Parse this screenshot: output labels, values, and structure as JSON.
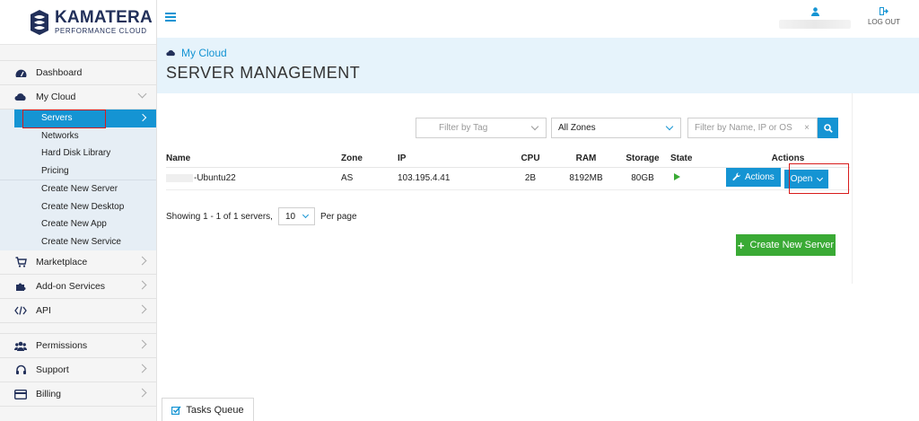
{
  "brand": {
    "name": "KAMATERA",
    "tagline": "PERFORMANCE CLOUD"
  },
  "header": {
    "logout_label": "LOG OUT"
  },
  "breadcrumb": "My Cloud",
  "page_title": "SERVER MANAGEMENT",
  "sidebar": {
    "items": [
      {
        "label": "Dashboard",
        "icon": "dashboard-icon"
      },
      {
        "label": "My Cloud",
        "icon": "cloud-icon"
      },
      {
        "label": "Marketplace",
        "icon": "cart-icon"
      },
      {
        "label": "Add-on Services",
        "icon": "puzzle-icon"
      },
      {
        "label": "API",
        "icon": "code-icon"
      },
      {
        "label": "Permissions",
        "icon": "users-icon"
      },
      {
        "label": "Support",
        "icon": "headset-icon"
      },
      {
        "label": "Billing",
        "icon": "card-icon"
      }
    ],
    "submenu": [
      "Servers",
      "Networks",
      "Hard Disk Library",
      "Pricing",
      "Create New Server",
      "Create New Desktop",
      "Create New App",
      "Create New Service"
    ]
  },
  "filters": {
    "tag_placeholder": "Filter by Tag",
    "zone_value": "All Zones",
    "search_placeholder": "Filter by Name, IP or OS",
    "clear": "×"
  },
  "table": {
    "headers": {
      "name": "Name",
      "zone": "Zone",
      "ip": "IP",
      "cpu": "CPU",
      "ram": "RAM",
      "storage": "Storage",
      "state": "State",
      "actions": "Actions"
    },
    "row": {
      "name": "-Ubuntu22",
      "zone": "AS",
      "ip": "103.195.4.41",
      "cpu": "2B",
      "ram": "8192MB",
      "storage": "80GB",
      "state": "running"
    },
    "actions_label": "Actions",
    "open_label": "Open"
  },
  "pagination": {
    "showing": "Showing 1 - 1 of 1 servers,",
    "per_page_value": "10",
    "per_page_label": "Per page"
  },
  "create_button": "Create New Server",
  "tasks_queue": "Tasks Queue",
  "colors": {
    "accent": "#1594d3",
    "success": "#3aaa35",
    "highlight": "#d81b1b",
    "brand": "#22305a"
  }
}
